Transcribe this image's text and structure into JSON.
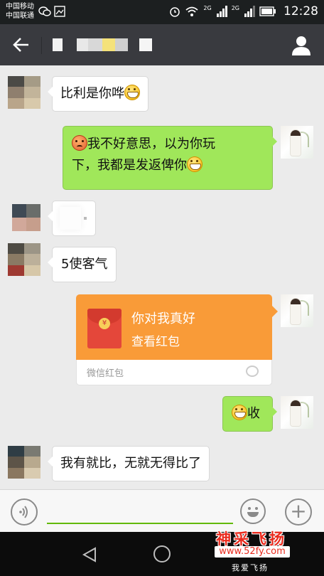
{
  "status_bar": {
    "carrier_1": "中国移动",
    "carrier_2": "中国联通",
    "net_1": "2G",
    "net_2": "2G",
    "time": "12:28"
  },
  "nav_bar": {
    "back_icon": "arrow-left-icon",
    "profile_icon": "person-icon"
  },
  "messages": [
    {
      "side": "in",
      "text": "比利是你哗",
      "emoji_after": "grin"
    },
    {
      "side": "out",
      "emoji_before": "angry",
      "line1": "我不好意思，以为你玩",
      "line2": "下，我都是发返俾你",
      "emoji_after": "grin"
    },
    {
      "side": "in",
      "type": "blurred-image"
    },
    {
      "side": "in",
      "text": "5使客气"
    },
    {
      "side": "out",
      "type": "red-packet",
      "title": "你对我真好",
      "subtitle": "查看红包",
      "label": "微信红包"
    },
    {
      "side": "out",
      "emoji_before": "grin",
      "text": "收"
    },
    {
      "side": "in",
      "text": "我有就比，无就无得比了"
    }
  ],
  "input_bar": {
    "voice_icon": "voice-icon",
    "placeholder": "",
    "emoji_icon": "emoji-icon",
    "plus_icon": "plus-icon",
    "plus_glyph": "+"
  },
  "watermark": {
    "title": "神采飞扬",
    "url": "www.52fy.com",
    "slogan": "我爱飞扬"
  },
  "colors": {
    "incoming_bubble": "#ffffff",
    "outgoing_bubble": "#a0e75a",
    "red_packet": "#f99b38",
    "nav_bar": "#393a3f",
    "input_underline": "#62b900"
  }
}
